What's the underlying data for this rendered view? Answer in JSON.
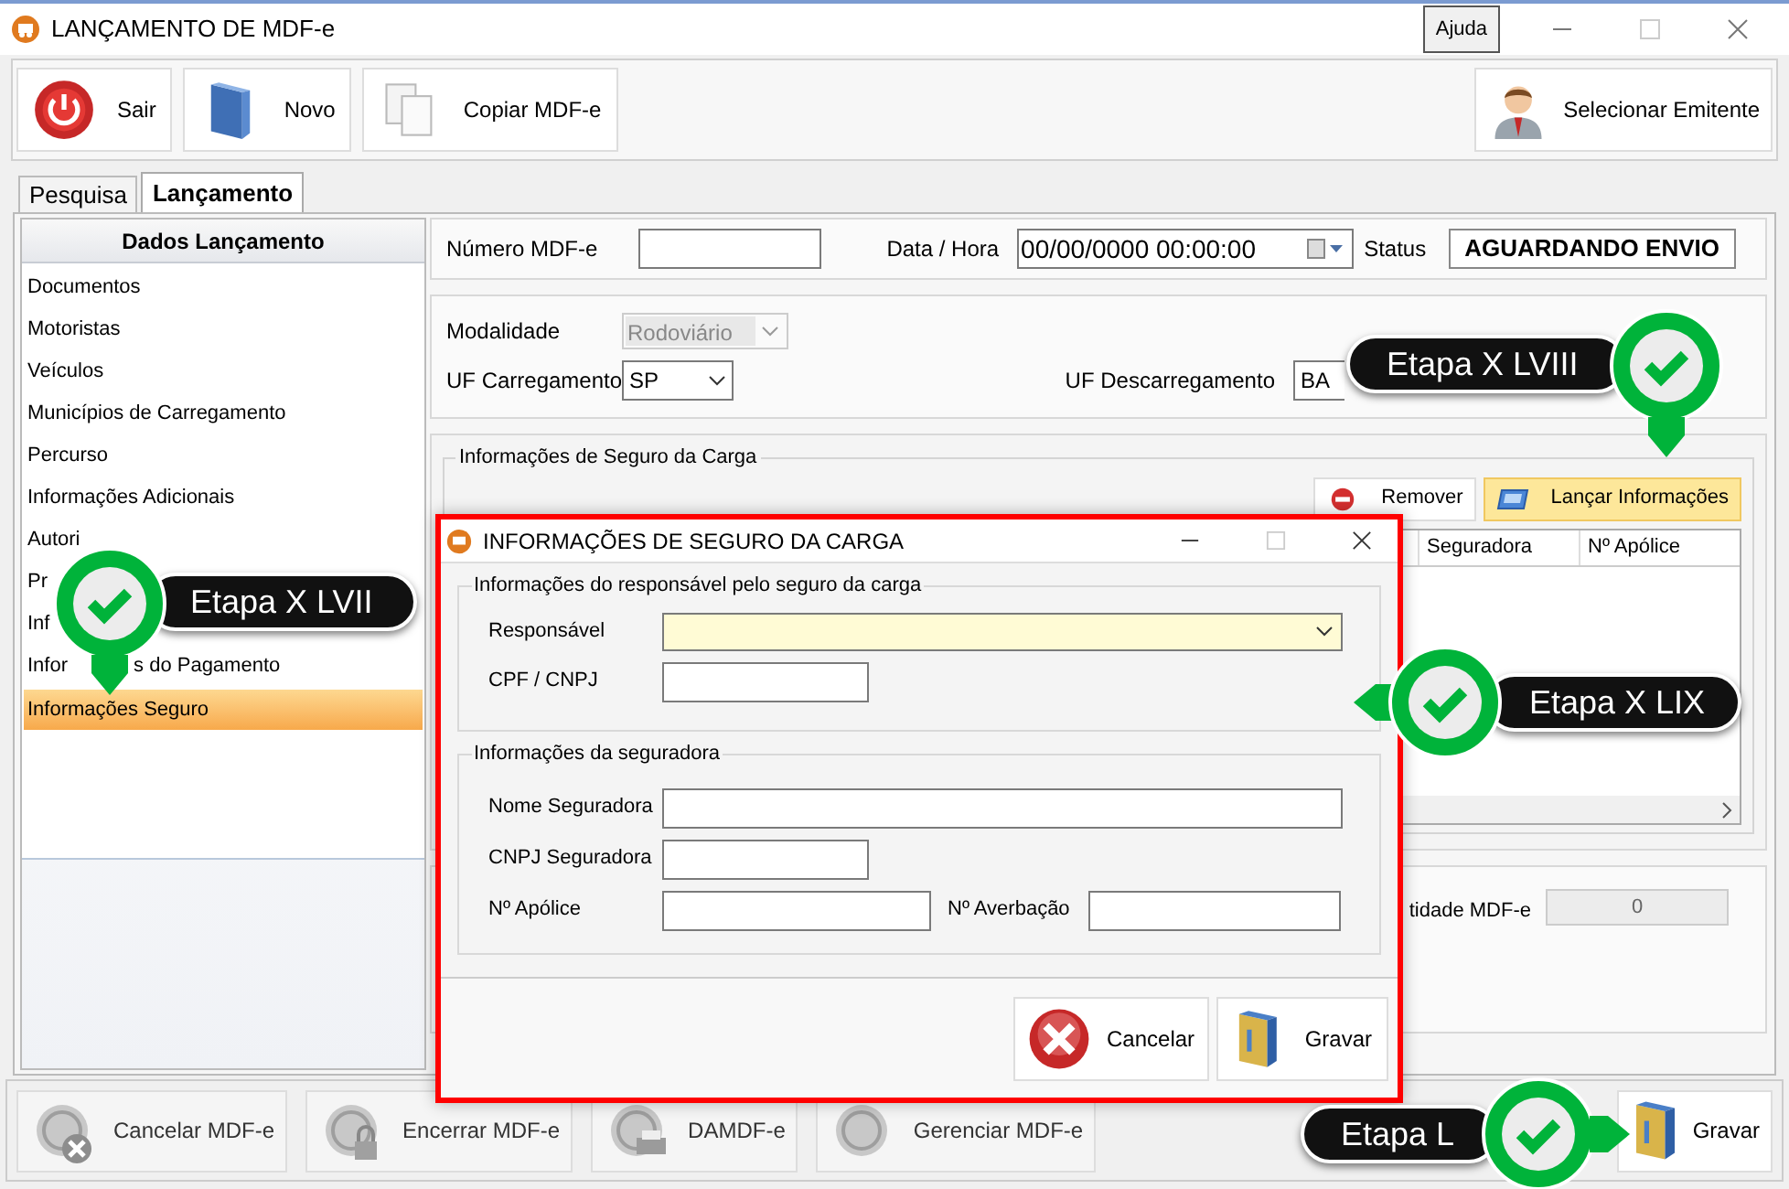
{
  "window": {
    "title": "LANÇAMENTO DE MDF-e",
    "help_button": "Ajuda"
  },
  "toolbar": [
    {
      "label": "Sair",
      "kind": "power"
    },
    {
      "label": "Novo",
      "kind": "folder"
    },
    {
      "label": "Copiar MDF-e",
      "kind": "copy"
    }
  ],
  "emitter_button": {
    "label": "Selecionar Emitente"
  },
  "tabs": [
    {
      "label": "Pesquisa",
      "selected": false
    },
    {
      "label": "Lançamento",
      "selected": true
    }
  ],
  "sidebar": {
    "title": "Dados Lançamento",
    "items": [
      {
        "label": "Documentos",
        "selected": false
      },
      {
        "label": "Motoristas",
        "selected": false
      },
      {
        "label": "Veículos",
        "selected": false
      },
      {
        "label": "Municípios de Carregamento",
        "selected": false
      },
      {
        "label": "Percurso",
        "selected": false
      },
      {
        "label": "Informações Adicionais",
        "selected": false
      },
      {
        "label": "Autori",
        "selected": false
      },
      {
        "label": "Pr",
        "selected": false
      },
      {
        "label": "Inf",
        "selected": false
      },
      {
        "label": "Infor",
        "tail": "s do Pagamento",
        "selected": false
      },
      {
        "label": "Informações Seguro",
        "selected": true
      }
    ]
  },
  "header": {
    "number_label": "Número MDF-e",
    "date_label": "Data / Hora",
    "date_value": "00/00/0000 00:00:00",
    "status_label": "Status",
    "status_value": "AGUARDANDO ENVIO"
  },
  "route": {
    "modality_label": "Modalidade",
    "modality_value": "Rodoviário",
    "modality_disabled": true,
    "loading_label": "UF Carregamento",
    "loading_value": "SP",
    "unloading_label": "UF Descarregamento",
    "unloading_value": "BA"
  },
  "insurance": {
    "legend": "Informações de Seguro da Carga",
    "buttons": [
      {
        "label": "Remover",
        "kind": "remove",
        "highlighted": false
      },
      {
        "label": "Lançar Informações",
        "kind": "launch",
        "highlighted": true
      }
    ],
    "columns": [
      "Seguradora",
      "Nº Apólice"
    ]
  },
  "totals": {
    "label": "tidade MDF-e",
    "value": "0"
  },
  "bottom_buttons": [
    {
      "label": "Cancelar MDF-e",
      "kind": "cancel"
    },
    {
      "label": "Encerrar MDF-e",
      "kind": "lock"
    },
    {
      "label": "DAMDF-e",
      "kind": "print"
    },
    {
      "label": "Gerenciar MDF-e",
      "kind": "manage"
    }
  ],
  "save_button": {
    "label": "Gravar"
  },
  "dialog": {
    "title": "INFORMAÇÕES DE SEGURO DA CARGA",
    "responsible_group": {
      "legend": "Informações do responsável pelo seguro da carga",
      "responsible_label": "Responsável",
      "document_label": "CPF / CNPJ"
    },
    "insurer_group": {
      "legend": "Informações da seguradora",
      "name_label": "Nome Seguradora",
      "cnpj_label": "CNPJ Seguradora",
      "policy_label": "Nº Apólice",
      "endorsement_label": "Nº Averbação"
    },
    "cancel_button": "Cancelar",
    "save_button": "Gravar"
  },
  "steps": [
    {
      "label": "Etapa X LVII"
    },
    {
      "label": "Etapa X LVIII"
    },
    {
      "label": "Etapa X LIX"
    },
    {
      "label": "Etapa L"
    }
  ]
}
